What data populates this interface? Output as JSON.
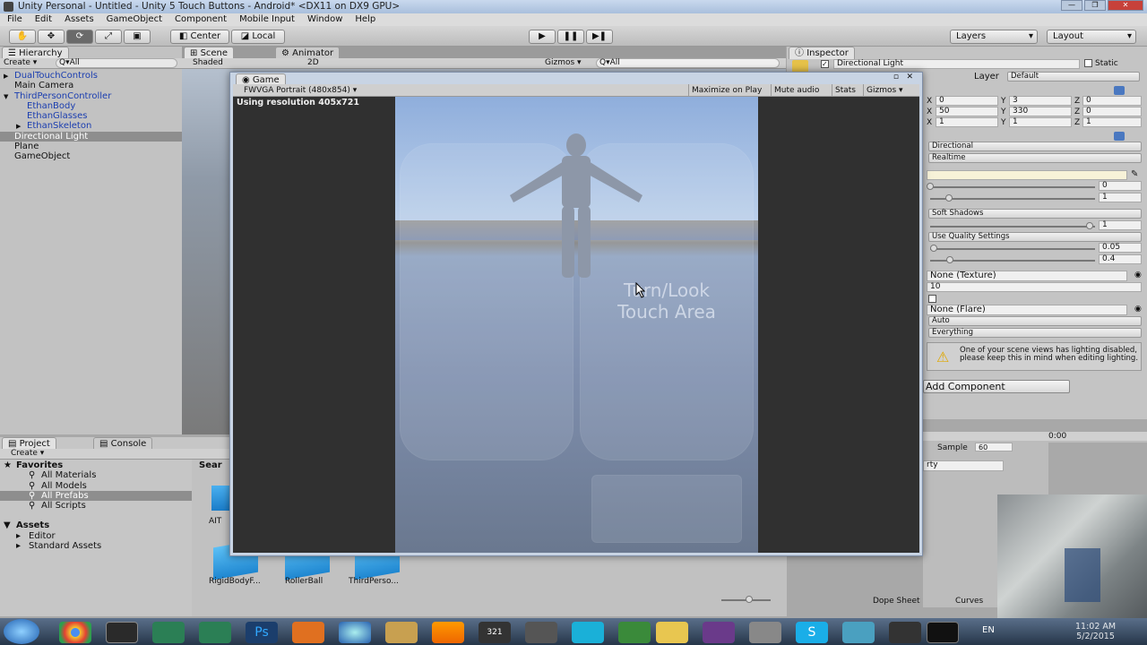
{
  "window": {
    "title": "Unity Personal - Untitled - Unity 5 Touch Buttons - Android* <DX11 on DX9 GPU>"
  },
  "menu": [
    "File",
    "Edit",
    "Assets",
    "GameObject",
    "Component",
    "Mobile Input",
    "Window",
    "Help"
  ],
  "toolbar": {
    "center": "Center",
    "local": "Local",
    "layers": "Layers",
    "layout": "Layout"
  },
  "hierarchy": {
    "tab": "Hierarchy",
    "create": "Create",
    "search": "Q▾All",
    "items": [
      {
        "label": "DualTouchControls",
        "blue": true,
        "indent": 0,
        "arrow": "▶"
      },
      {
        "label": "Main Camera",
        "blue": false,
        "indent": 0,
        "arrow": ""
      },
      {
        "label": "ThirdPersonController",
        "blue": true,
        "indent": 0,
        "arrow": "▼"
      },
      {
        "label": "EthanBody",
        "blue": true,
        "indent": 1,
        "arrow": ""
      },
      {
        "label": "EthanGlasses",
        "blue": true,
        "indent": 1,
        "arrow": ""
      },
      {
        "label": "EthanSkeleton",
        "blue": true,
        "indent": 1,
        "arrow": "▶"
      },
      {
        "label": "Directional Light",
        "blue": false,
        "indent": 0,
        "arrow": "",
        "selected": true
      },
      {
        "label": "Plane",
        "blue": false,
        "indent": 0,
        "arrow": ""
      },
      {
        "label": "GameObject",
        "blue": false,
        "indent": 0,
        "arrow": ""
      }
    ]
  },
  "scene": {
    "tab_scene": "Scene",
    "tab_animator": "Animator",
    "shaded": "Shaded",
    "mode2d": "2D",
    "gizmos": "Gizmos ▾",
    "search": "Q▾All"
  },
  "game": {
    "tab": "Game",
    "resolution_dd": "FWVGA Portrait (480x854)",
    "using": "Using resolution 405x721",
    "maximize": "Maximize on Play",
    "mute": "Mute audio",
    "stats": "Stats",
    "gizmos": "Gizmos ▾",
    "touch_line1": "Turn/Look",
    "touch_line2": "Touch Area"
  },
  "inspector": {
    "tab": "Inspector",
    "object": "Directional Light",
    "static": "Static",
    "layer_label": "Layer",
    "layer_value": "Default",
    "position": {
      "x": "0",
      "y": "3",
      "z": "0"
    },
    "rotation": {
      "x": "50",
      "y": "330",
      "z": "0"
    },
    "scale": {
      "x": "1",
      "y": "1",
      "z": "1"
    },
    "type": "Directional",
    "baking": "Realtime",
    "intensity": "0",
    "bounce": "1",
    "shadow_type": "Soft Shadows",
    "strength": "1",
    "resolution": "Use Quality Settings",
    "bias": "0.05",
    "normal_bias": "0.4",
    "cookie": "None (Texture)",
    "cookie_size": "10",
    "flare": "None (Flare)",
    "render_mode": "Auto",
    "culling": "Everything",
    "warning": "One of your scene views has lighting disabled, please keep this in mind when editing lighting.",
    "add_component": "Add Component"
  },
  "project": {
    "tab_project": "Project",
    "tab_console": "Console",
    "create": "Create ▾",
    "favorites": "Favorites",
    "fav_items": [
      "All Materials",
      "All Models",
      "All Prefabs",
      "All Scripts"
    ],
    "assets": "Assets",
    "asset_items": [
      "Editor",
      "Standard Assets"
    ],
    "search_label": "Sear",
    "files": [
      "RigidBodyF...",
      "RollerBall",
      "ThirdPerso...",
      "AIT"
    ]
  },
  "animation": {
    "sample_label": "Sample",
    "sample_value": "60",
    "time": "0:00",
    "property": "rty",
    "dope": "Dope Sheet",
    "curves": "Curves"
  },
  "taskbar": {
    "lang": "EN",
    "time": "11:02 AM",
    "date": "5/2/2015"
  }
}
